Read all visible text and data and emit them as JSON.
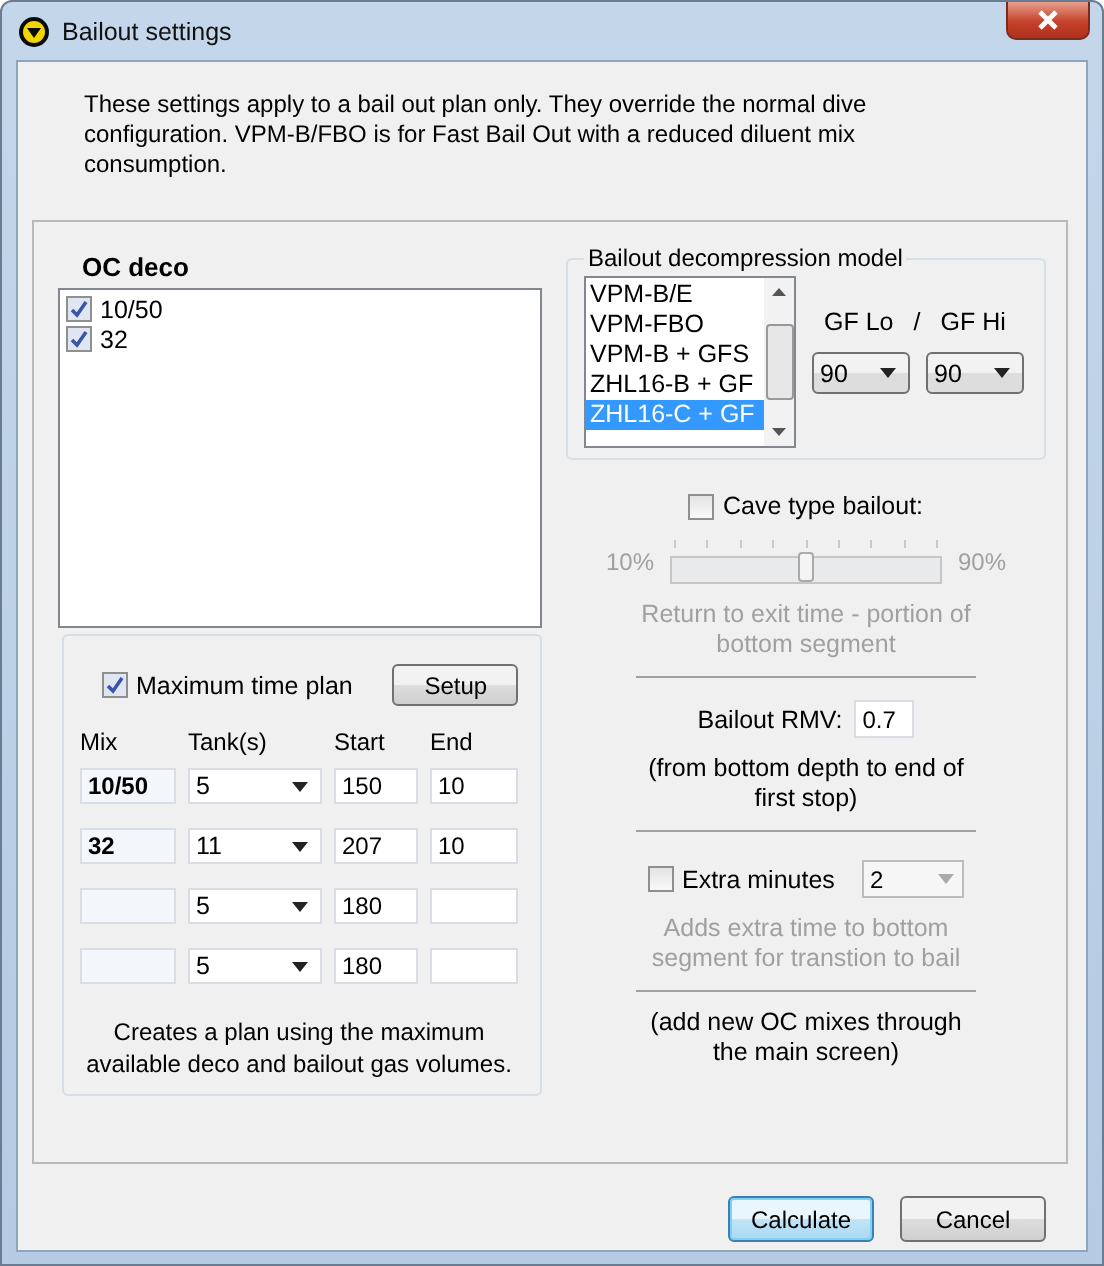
{
  "window": {
    "title": "Bailout settings"
  },
  "intro": "These settings apply to a bail out plan only.  They override the normal dive configuration.  VPM-B/FBO is for Fast Bail Out with a reduced diluent mix consumption.",
  "oc_deco": {
    "label": "OC deco",
    "items": [
      {
        "label": "10/50",
        "checked": true
      },
      {
        "label": "32",
        "checked": true
      }
    ]
  },
  "max_time_plan": {
    "label": "Maximum time plan",
    "checked": true,
    "setup_button": "Setup"
  },
  "tank_table": {
    "columns": [
      "Mix",
      "Tank(s)",
      "Start",
      "End"
    ],
    "rows": [
      {
        "mix": "10/50",
        "tanks": "5",
        "start": "150",
        "end": "10"
      },
      {
        "mix": "32",
        "tanks": "11",
        "start": "207",
        "end": "10"
      },
      {
        "tanks": "5",
        "start": "180"
      },
      {
        "tanks": "5",
        "start": "180"
      }
    ]
  },
  "max_plan_note": "Creates a plan using the maximum available deco and bailout gas volumes.",
  "model": {
    "label": "Bailout decompression model",
    "items": [
      {
        "label": "VPM-B/E",
        "selected": false
      },
      {
        "label": "VPM-FBO",
        "selected": false
      },
      {
        "label": "VPM-B + GFS",
        "selected": false
      },
      {
        "label": "ZHL16-B + GF",
        "selected": false
      },
      {
        "label": "ZHL16-C + GF",
        "selected": true
      }
    ],
    "gf_lo_label": "GF Lo",
    "gf_separator": "/",
    "gf_hi_label": "GF Hi",
    "gf_lo": "90",
    "gf_hi": "90"
  },
  "cave": {
    "label": "Cave type bailout:",
    "checked": false,
    "disabled": true,
    "min_label": "10%",
    "max_label": "90%",
    "level": 0.5,
    "description": "Return to exit time - portion of bottom segment"
  },
  "rmv": {
    "label": "Bailout RMV:",
    "value": "0.7",
    "note": "(from bottom depth to end of first stop)"
  },
  "extra": {
    "label": "Extra minutes",
    "checked": false,
    "disabled": true,
    "value": "2",
    "description": "Adds extra time to bottom segment  for transtion to bail"
  },
  "footer_note": "(add new OC mixes through the main screen)",
  "buttons": [
    {
      "label": "Calculate",
      "default": true
    },
    {
      "label": "Cancel",
      "default": false
    }
  ]
}
